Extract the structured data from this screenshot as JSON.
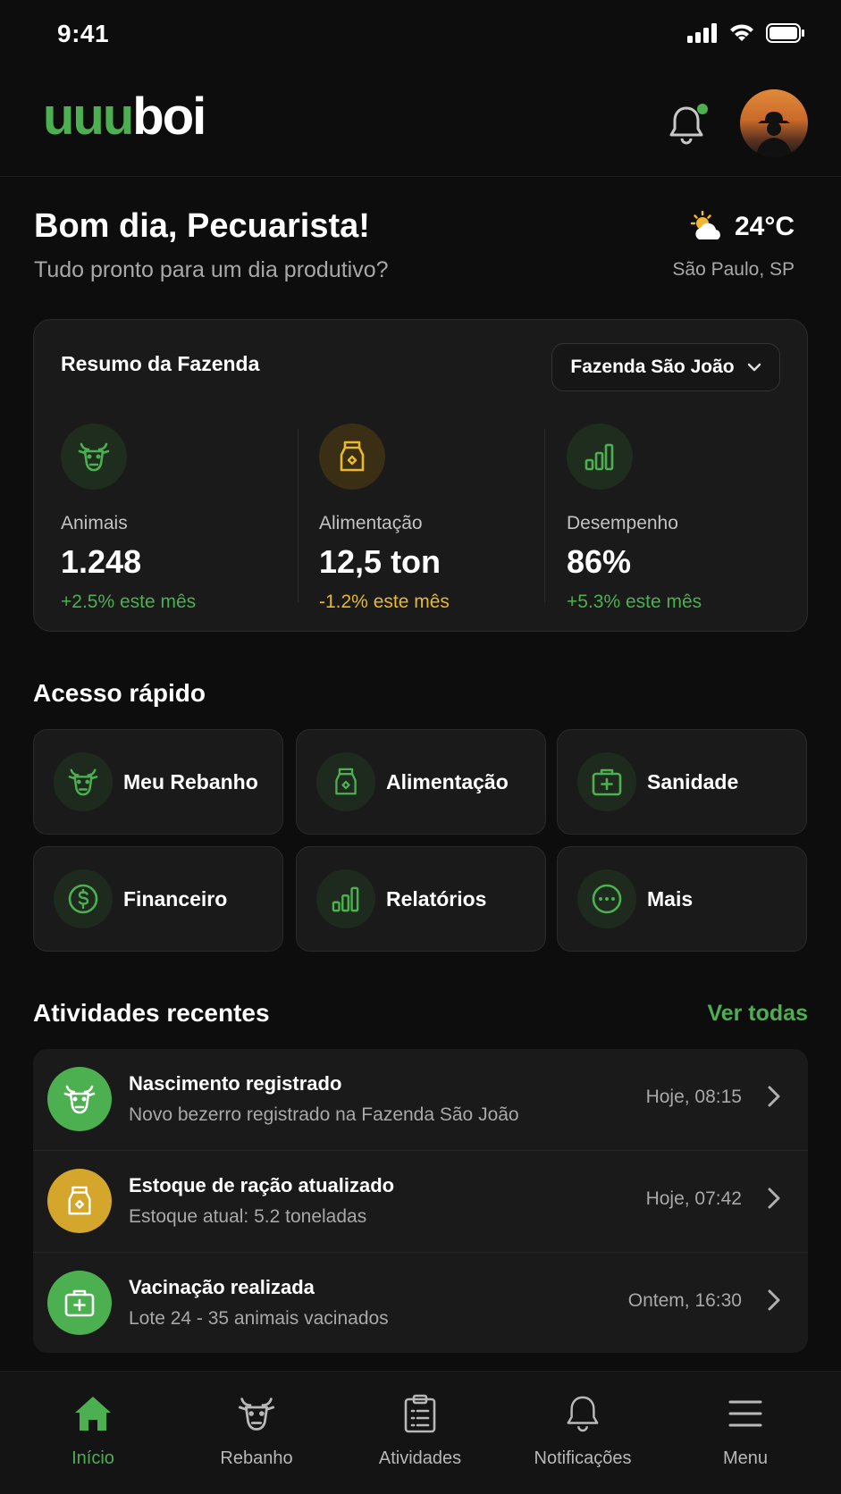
{
  "status_bar": {
    "time": "9:41"
  },
  "header": {
    "logo_green": "uuu",
    "logo_white": "boi"
  },
  "greeting": {
    "title": "Bom dia, Pecuarista!",
    "subtitle": "Tudo pronto para um dia produtivo?"
  },
  "weather": {
    "temperature": "24°C",
    "location": "São Paulo, SP",
    "icon": "partly-cloudy-icon"
  },
  "summary": {
    "title": "Resumo da Fazenda",
    "farm_selected": "Fazenda São João",
    "stats": [
      {
        "icon": "cattle-icon",
        "label": "Animais",
        "value": "1.248",
        "trend": "+2.5% este mês",
        "trend_color": "#4caf50"
      },
      {
        "icon": "feed-bag-icon",
        "label": "Alimentação",
        "value": "12,5 ton",
        "trend": "-1.2% este mês",
        "trend_color": "#e8b830"
      },
      {
        "icon": "bar-chart-icon",
        "label": "Desempenho",
        "value": "86%",
        "trend": "+5.3% este mês",
        "trend_color": "#4caf50"
      }
    ]
  },
  "quick_access": {
    "title": "Acesso rápido",
    "items": [
      {
        "label": "Meu Rebanho",
        "icon": "cattle-icon"
      },
      {
        "label": "Alimentação",
        "icon": "feed-bag-icon"
      },
      {
        "label": "Sanidade",
        "icon": "medical-kit-icon"
      },
      {
        "label": "Financeiro",
        "icon": "dollar-icon"
      },
      {
        "label": "Relatórios",
        "icon": "bar-chart-icon"
      },
      {
        "label": "Mais",
        "icon": "more-icon"
      }
    ]
  },
  "activities": {
    "title": "Atividades recentes",
    "see_all": "Ver todas",
    "items": [
      {
        "title": "Nascimento registrado",
        "subtitle": "Novo bezerro registrado na Fazenda São João",
        "time": "Hoje, 08:15",
        "icon": "cattle-icon",
        "color": "#4caf50"
      },
      {
        "title": "Estoque de ração atualizado",
        "subtitle": "Estoque atual: 5.2 toneladas",
        "time": "Hoje, 07:42",
        "icon": "feed-bag-icon",
        "color": "#d4a72c"
      },
      {
        "title": "Vacinação realizada",
        "subtitle": "Lote 24 - 35 animais vacinados",
        "time": "Ontem, 16:30",
        "icon": "medical-kit-icon",
        "color": "#4caf50"
      }
    ]
  },
  "bottom_nav": {
    "items": [
      {
        "label": "Início",
        "icon": "home-icon",
        "active": true
      },
      {
        "label": "Rebanho",
        "icon": "cattle-icon",
        "active": false
      },
      {
        "label": "Atividades",
        "icon": "clipboard-icon",
        "active": false
      },
      {
        "label": "Notificações",
        "icon": "bell-icon",
        "active": false
      },
      {
        "label": "Menu",
        "icon": "menu-icon",
        "active": false
      }
    ]
  },
  "colors": {
    "accent_green": "#4caf50",
    "accent_yellow": "#e8b830",
    "background": "#0d0d0d",
    "card": "#1a1a1a"
  }
}
